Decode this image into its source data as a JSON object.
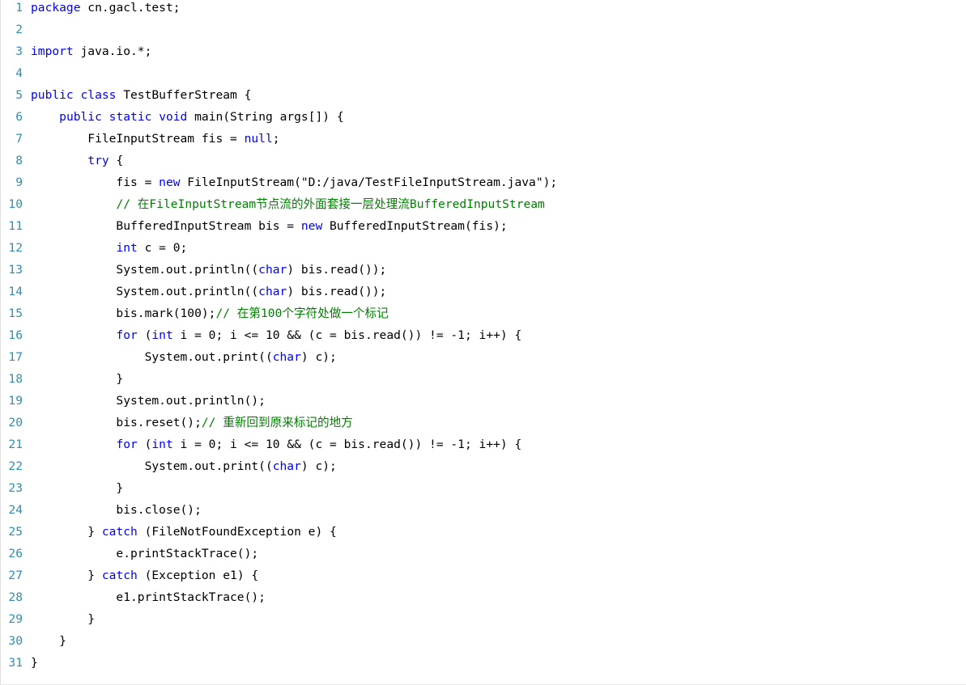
{
  "colors": {
    "background": "#ffffff",
    "line_number": "#2b91af",
    "keyword": "#0000ff",
    "comment": "#008000",
    "text": "#000000"
  },
  "lines": [
    {
      "num": "1",
      "tokens": [
        {
          "t": "package",
          "k": "kw"
        },
        {
          "t": " cn.gacl.test;",
          "k": "tx"
        }
      ]
    },
    {
      "num": "2",
      "tokens": []
    },
    {
      "num": "3",
      "tokens": [
        {
          "t": "import",
          "k": "kw"
        },
        {
          "t": " java.io.*;",
          "k": "tx"
        }
      ]
    },
    {
      "num": "4",
      "tokens": []
    },
    {
      "num": "5",
      "tokens": [
        {
          "t": "public",
          "k": "kw"
        },
        {
          "t": " ",
          "k": "tx"
        },
        {
          "t": "class",
          "k": "kw"
        },
        {
          "t": " TestBufferStream {",
          "k": "tx"
        }
      ]
    },
    {
      "num": "6",
      "tokens": [
        {
          "t": "    ",
          "k": "tx"
        },
        {
          "t": "public",
          "k": "kw"
        },
        {
          "t": " ",
          "k": "tx"
        },
        {
          "t": "static",
          "k": "kw"
        },
        {
          "t": " ",
          "k": "tx"
        },
        {
          "t": "void",
          "k": "kw"
        },
        {
          "t": " main(String args[]) {",
          "k": "tx"
        }
      ]
    },
    {
      "num": "7",
      "tokens": [
        {
          "t": "        FileInputStream fis = ",
          "k": "tx"
        },
        {
          "t": "null",
          "k": "kw"
        },
        {
          "t": ";",
          "k": "tx"
        }
      ]
    },
    {
      "num": "8",
      "tokens": [
        {
          "t": "        ",
          "k": "tx"
        },
        {
          "t": "try",
          "k": "kw"
        },
        {
          "t": " {",
          "k": "tx"
        }
      ]
    },
    {
      "num": "9",
      "tokens": [
        {
          "t": "            fis = ",
          "k": "tx"
        },
        {
          "t": "new",
          "k": "kw"
        },
        {
          "t": " FileInputStream(\"D:/java/TestFileInputStream.java\");",
          "k": "tx"
        }
      ]
    },
    {
      "num": "10",
      "tokens": [
        {
          "t": "            ",
          "k": "tx"
        },
        {
          "t": "// 在FileInputStream节点流的外面套接一层处理流BufferedInputStream",
          "k": "cm"
        }
      ]
    },
    {
      "num": "11",
      "tokens": [
        {
          "t": "            BufferedInputStream bis = ",
          "k": "tx"
        },
        {
          "t": "new",
          "k": "kw"
        },
        {
          "t": " BufferedInputStream(fis);",
          "k": "tx"
        }
      ]
    },
    {
      "num": "12",
      "tokens": [
        {
          "t": "            ",
          "k": "tx"
        },
        {
          "t": "int",
          "k": "kw"
        },
        {
          "t": " c = 0;",
          "k": "tx"
        }
      ]
    },
    {
      "num": "13",
      "tokens": [
        {
          "t": "            System.out.println((",
          "k": "tx"
        },
        {
          "t": "char",
          "k": "kw"
        },
        {
          "t": ") bis.read());",
          "k": "tx"
        }
      ]
    },
    {
      "num": "14",
      "tokens": [
        {
          "t": "            System.out.println((",
          "k": "tx"
        },
        {
          "t": "char",
          "k": "kw"
        },
        {
          "t": ") bis.read());",
          "k": "tx"
        }
      ]
    },
    {
      "num": "15",
      "tokens": [
        {
          "t": "            bis.mark(100);",
          "k": "tx"
        },
        {
          "t": "// 在第100个字符处做一个标记",
          "k": "cm"
        }
      ]
    },
    {
      "num": "16",
      "tokens": [
        {
          "t": "            ",
          "k": "tx"
        },
        {
          "t": "for",
          "k": "kw"
        },
        {
          "t": " (",
          "k": "tx"
        },
        {
          "t": "int",
          "k": "kw"
        },
        {
          "t": " i = 0; i <= 10 && (c = bis.read()) != -1; i++) {",
          "k": "tx"
        }
      ]
    },
    {
      "num": "17",
      "tokens": [
        {
          "t": "                System.out.print((",
          "k": "tx"
        },
        {
          "t": "char",
          "k": "kw"
        },
        {
          "t": ") c);",
          "k": "tx"
        }
      ]
    },
    {
      "num": "18",
      "tokens": [
        {
          "t": "            }",
          "k": "tx"
        }
      ]
    },
    {
      "num": "19",
      "tokens": [
        {
          "t": "            System.out.println();",
          "k": "tx"
        }
      ]
    },
    {
      "num": "20",
      "tokens": [
        {
          "t": "            bis.reset();",
          "k": "tx"
        },
        {
          "t": "// 重新回到原来标记的地方",
          "k": "cm"
        }
      ]
    },
    {
      "num": "21",
      "tokens": [
        {
          "t": "            ",
          "k": "tx"
        },
        {
          "t": "for",
          "k": "kw"
        },
        {
          "t": " (",
          "k": "tx"
        },
        {
          "t": "int",
          "k": "kw"
        },
        {
          "t": " i = 0; i <= 10 && (c = bis.read()) != -1; i++) {",
          "k": "tx"
        }
      ]
    },
    {
      "num": "22",
      "tokens": [
        {
          "t": "                System.out.print((",
          "k": "tx"
        },
        {
          "t": "char",
          "k": "kw"
        },
        {
          "t": ") c);",
          "k": "tx"
        }
      ]
    },
    {
      "num": "23",
      "tokens": [
        {
          "t": "            }",
          "k": "tx"
        }
      ]
    },
    {
      "num": "24",
      "tokens": [
        {
          "t": "            bis.close();",
          "k": "tx"
        }
      ]
    },
    {
      "num": "25",
      "tokens": [
        {
          "t": "        } ",
          "k": "tx"
        },
        {
          "t": "catch",
          "k": "kw"
        },
        {
          "t": " (FileNotFoundException e) {",
          "k": "tx"
        }
      ]
    },
    {
      "num": "26",
      "tokens": [
        {
          "t": "            e.printStackTrace();",
          "k": "tx"
        }
      ]
    },
    {
      "num": "27",
      "tokens": [
        {
          "t": "        } ",
          "k": "tx"
        },
        {
          "t": "catch",
          "k": "kw"
        },
        {
          "t": " (Exception e1) {",
          "k": "tx"
        }
      ]
    },
    {
      "num": "28",
      "tokens": [
        {
          "t": "            e1.printStackTrace();",
          "k": "tx"
        }
      ]
    },
    {
      "num": "29",
      "tokens": [
        {
          "t": "        }",
          "k": "tx"
        }
      ]
    },
    {
      "num": "30",
      "tokens": [
        {
          "t": "    }",
          "k": "tx"
        }
      ]
    },
    {
      "num": "31",
      "tokens": [
        {
          "t": "}",
          "k": "tx"
        }
      ]
    }
  ]
}
